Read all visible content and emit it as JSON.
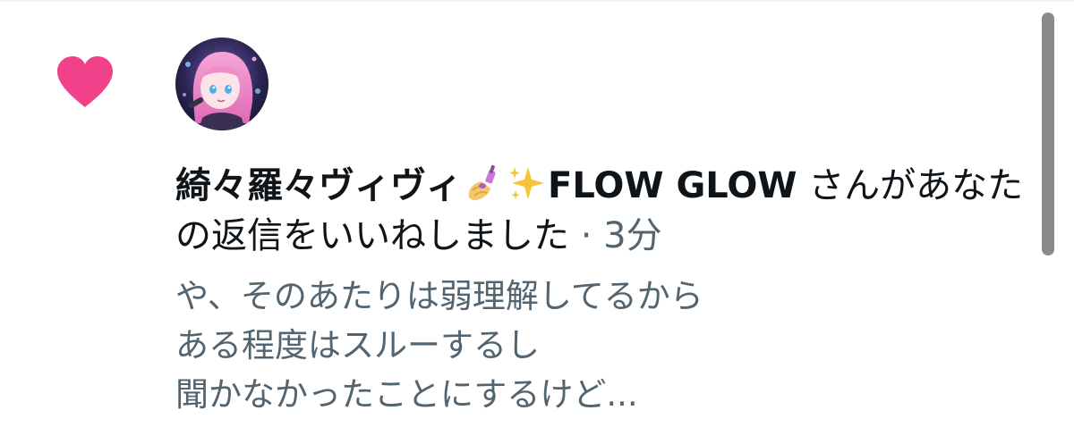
{
  "notification": {
    "type_icon": "heart-icon",
    "accent_color": "#f0418a",
    "avatar": "avatar",
    "user_name": "綺々羅々ヴィヴィ",
    "emojis": [
      "nail-polish-icon",
      "sparkles-icon"
    ],
    "user_name_suffix": "FLOW GLOW",
    "action_text": "さんがあなたの返信をいいねしました",
    "separator": "·",
    "time_ago": "3分",
    "tweet_lines": [
      "や、そのあたりは弱理解してるから",
      "ある程度はスルーするし",
      "聞かなかったことにするけど..."
    ]
  },
  "colors": {
    "primary_text": "#0f1419",
    "secondary_text": "#536471",
    "like_pink": "#f0418a",
    "scrollbar": "#8a8a8e"
  }
}
